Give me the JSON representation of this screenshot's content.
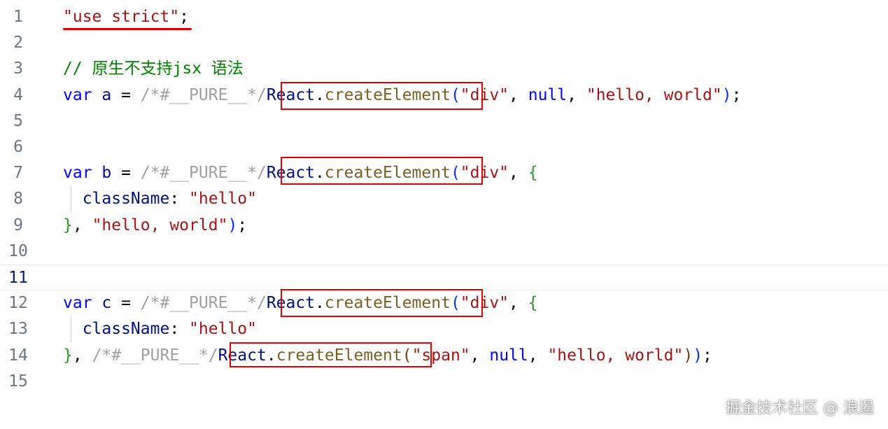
{
  "editor": {
    "lines": [
      {
        "num": "1",
        "segments": [
          {
            "t": "\"use strict\"",
            "c": "str"
          },
          {
            "t": ";",
            "c": "pun"
          }
        ]
      },
      {
        "num": "2",
        "segments": []
      },
      {
        "num": "3",
        "segments": [
          {
            "t": "// 原生不支持jsx 语法",
            "c": "cmt"
          }
        ]
      },
      {
        "num": "4",
        "segments": [
          {
            "t": "var",
            "c": "kw"
          },
          {
            "t": " a ",
            "c": "var"
          },
          {
            "t": "= ",
            "c": "pun"
          },
          {
            "t": "/*#__PURE__*/",
            "c": "cmt2"
          },
          {
            "t": "React",
            "c": "var"
          },
          {
            "t": ".",
            "c": "pun"
          },
          {
            "t": "createElement",
            "c": "fn"
          },
          {
            "t": "(",
            "c": "br1"
          },
          {
            "t": "\"div\"",
            "c": "str"
          },
          {
            "t": ", ",
            "c": "pun"
          },
          {
            "t": "null",
            "c": "null"
          },
          {
            "t": ", ",
            "c": "pun"
          },
          {
            "t": "\"hello, world\"",
            "c": "str"
          },
          {
            "t": ")",
            "c": "br1"
          },
          {
            "t": ";",
            "c": "pun"
          }
        ]
      },
      {
        "num": "5",
        "segments": []
      },
      {
        "num": "6",
        "segments": []
      },
      {
        "num": "7",
        "segments": [
          {
            "t": "var",
            "c": "kw"
          },
          {
            "t": " b ",
            "c": "var"
          },
          {
            "t": "= ",
            "c": "pun"
          },
          {
            "t": "/*#__PURE__*/",
            "c": "cmt2"
          },
          {
            "t": "React",
            "c": "var"
          },
          {
            "t": ".",
            "c": "pun"
          },
          {
            "t": "createElement",
            "c": "fn"
          },
          {
            "t": "(",
            "c": "br1"
          },
          {
            "t": "\"div\"",
            "c": "str"
          },
          {
            "t": ", ",
            "c": "pun"
          },
          {
            "t": "{",
            "c": "br2"
          }
        ]
      },
      {
        "num": "8",
        "segments": [
          {
            "t": "  className",
            "c": "prop"
          },
          {
            "t": ": ",
            "c": "pun"
          },
          {
            "t": "\"hello\"",
            "c": "str"
          }
        ]
      },
      {
        "num": "9",
        "segments": [
          {
            "t": "}",
            "c": "br2"
          },
          {
            "t": ", ",
            "c": "pun"
          },
          {
            "t": "\"hello, world\"",
            "c": "str"
          },
          {
            "t": ")",
            "c": "br1"
          },
          {
            "t": ";",
            "c": "pun"
          }
        ]
      },
      {
        "num": "10",
        "segments": []
      },
      {
        "num": "11",
        "segments": []
      },
      {
        "num": "12",
        "segments": [
          {
            "t": "var",
            "c": "kw"
          },
          {
            "t": " c ",
            "c": "var"
          },
          {
            "t": "= ",
            "c": "pun"
          },
          {
            "t": "/*#__PURE__*/",
            "c": "cmt2"
          },
          {
            "t": "React",
            "c": "var"
          },
          {
            "t": ".",
            "c": "pun"
          },
          {
            "t": "createElement",
            "c": "fn"
          },
          {
            "t": "(",
            "c": "br1"
          },
          {
            "t": "\"div\"",
            "c": "str"
          },
          {
            "t": ", ",
            "c": "pun"
          },
          {
            "t": "{",
            "c": "br2"
          }
        ]
      },
      {
        "num": "13",
        "segments": [
          {
            "t": "  className",
            "c": "prop"
          },
          {
            "t": ": ",
            "c": "pun"
          },
          {
            "t": "\"hello\"",
            "c": "str"
          }
        ]
      },
      {
        "num": "14",
        "segments": [
          {
            "t": "}",
            "c": "br2"
          },
          {
            "t": ", ",
            "c": "pun"
          },
          {
            "t": "/*#__PURE__*/",
            "c": "cmt2"
          },
          {
            "t": "React",
            "c": "var"
          },
          {
            "t": ".",
            "c": "pun"
          },
          {
            "t": "createElement",
            "c": "fn"
          },
          {
            "t": "(",
            "c": "br3"
          },
          {
            "t": "\"span\"",
            "c": "str"
          },
          {
            "t": ", ",
            "c": "pun"
          },
          {
            "t": "null",
            "c": "null"
          },
          {
            "t": ", ",
            "c": "pun"
          },
          {
            "t": "\"hello, world\"",
            "c": "str"
          },
          {
            "t": ")",
            "c": "br3"
          },
          {
            "t": ")",
            "c": "br1"
          },
          {
            "t": ";",
            "c": "pun"
          }
        ]
      },
      {
        "num": "15",
        "segments": []
      }
    ],
    "active_line": "11",
    "highlight_color": "#e00000"
  },
  "watermark": "掘金技术社区 @ 浪遏"
}
